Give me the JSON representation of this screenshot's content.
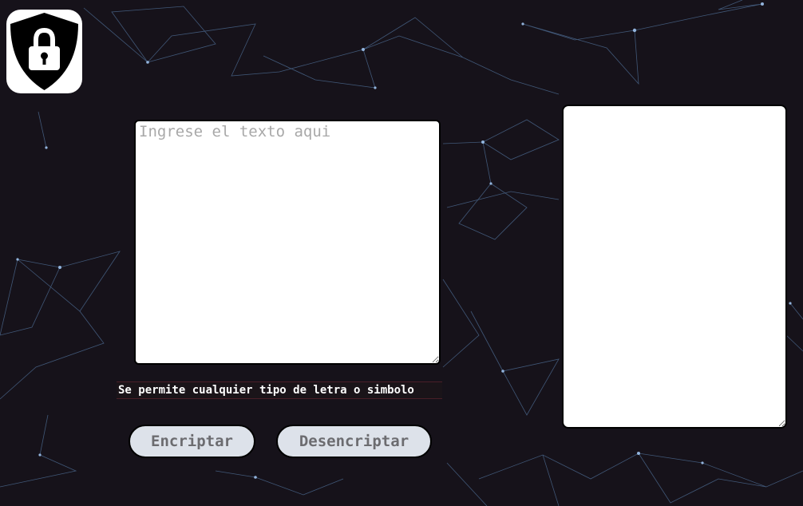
{
  "app": {
    "logo_icon": "shield-lock-icon"
  },
  "input": {
    "placeholder": "Ingrese el texto aqui",
    "value": ""
  },
  "hint": {
    "text": "Se permite cualquier tipo de letra o simbolo"
  },
  "buttons": {
    "encrypt_label": "Encriptar",
    "decrypt_label": "Desencriptar"
  },
  "output": {
    "value": ""
  },
  "colors": {
    "background": "#16121a",
    "button_fill": "#dde2ea",
    "button_text": "#6c6c70",
    "network_lines": "#5b7fa8"
  }
}
